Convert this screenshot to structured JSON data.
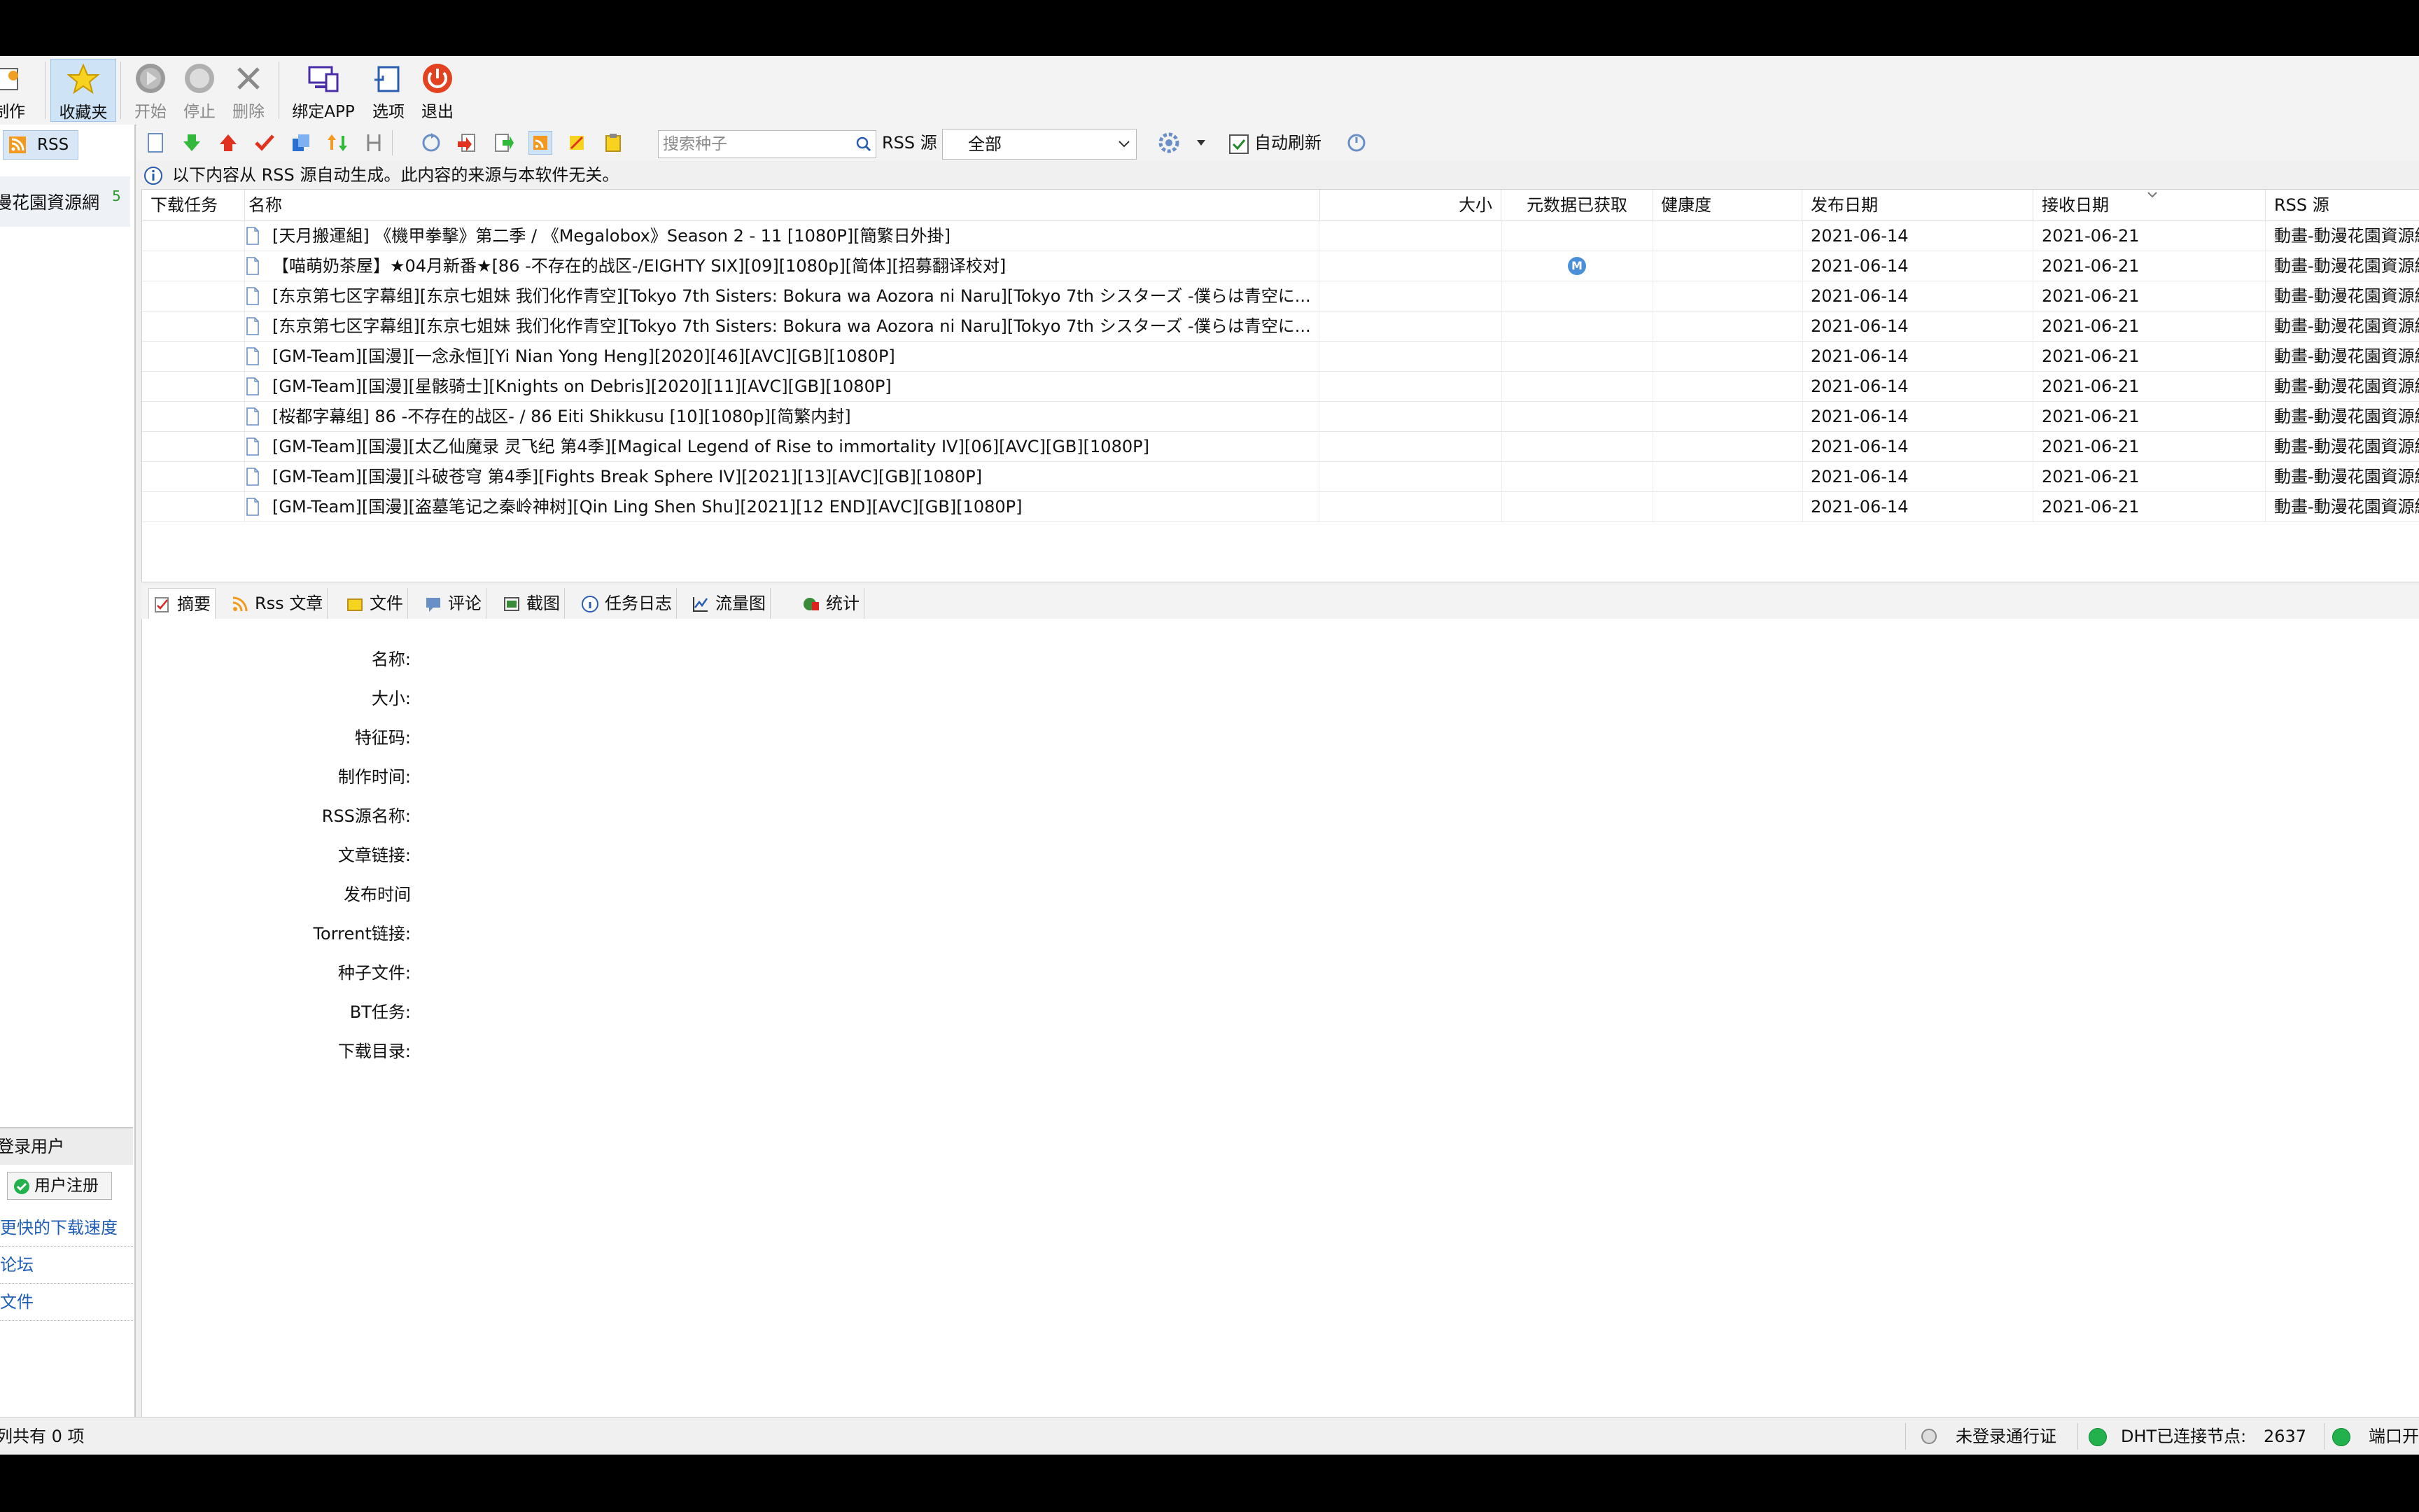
{
  "toolbar": {
    "make_label": "制作",
    "favorites_label": "收藏夹",
    "start_label": "开始",
    "stop_label": "停止",
    "delete_label": "删除",
    "bind_app_label": "绑定APP",
    "options_label": "选项",
    "exit_label": "退出"
  },
  "sidebar": {
    "rss_tab": "RSS",
    "feed_name": "漫花園資源網",
    "feed_count": "5",
    "login_header": "登录用户",
    "register_button": "用户注册",
    "links": [
      "更快的下载速度",
      "论坛",
      "文件"
    ]
  },
  "subbar": {
    "search_placeholder": "搜索种子",
    "rss_source_label": "RSS 源",
    "rss_source_value": "全部",
    "auto_refresh_label": "自动刷新",
    "auto_refresh_checked": true
  },
  "info_text": "以下内容从 RSS 源自动生成。此内容的来源与本软件无关。",
  "table": {
    "columns": [
      "下载任务",
      "名称",
      "大小",
      "元数据已获取",
      "健康度",
      "发布日期",
      "接收日期",
      "RSS 源"
    ],
    "rows": [
      {
        "name": "[天月搬運組] 《機甲拳擊》第二季 / 《Megalobox》Season 2 - 11 [1080P][簡繁日外掛]",
        "meta": "",
        "pub": "2021-06-14",
        "recv": "2021-06-21",
        "source": "動畫-動漫花園資源網"
      },
      {
        "name": "【喵萌奶茶屋】★04月新番★[86 -不存在的战区-/EIGHTY SIX][09][1080p][简体][招募翻译校对]",
        "meta": "M",
        "pub": "2021-06-14",
        "recv": "2021-06-21",
        "source": "動畫-動漫花園資源網"
      },
      {
        "name": "[东京第七区字幕组][东京七姐妹 我们化作青空][Tokyo 7th Sisters: Bokura wa Aozora ni Naru][Tokyo 7th シスターズ -僕らは青空に...",
        "meta": "",
        "pub": "2021-06-14",
        "recv": "2021-06-21",
        "source": "動畫-動漫花園資源網"
      },
      {
        "name": "[东京第七区字幕组][东京七姐妹 我们化作青空][Tokyo 7th Sisters: Bokura wa Aozora ni Naru][Tokyo 7th シスターズ -僕らは青空に...",
        "meta": "",
        "pub": "2021-06-14",
        "recv": "2021-06-21",
        "source": "動畫-動漫花園資源網"
      },
      {
        "name": "[GM-Team][国漫][一念永恒][Yi Nian Yong Heng][2020][46][AVC][GB][1080P]",
        "meta": "",
        "pub": "2021-06-14",
        "recv": "2021-06-21",
        "source": "動畫-動漫花園資源網"
      },
      {
        "name": "[GM-Team][国漫][星骸骑士][Knights on Debris][2020][11][AVC][GB][1080P]",
        "meta": "",
        "pub": "2021-06-14",
        "recv": "2021-06-21",
        "source": "動畫-動漫花園資源網"
      },
      {
        "name": "[桜都字幕组] 86 -不存在的战区- / 86 Eiti Shikkusu [10][1080p][简繁内封]",
        "meta": "",
        "pub": "2021-06-14",
        "recv": "2021-06-21",
        "source": "動畫-動漫花園資源網"
      },
      {
        "name": "[GM-Team][国漫][太乙仙魔录 灵飞纪 第4季][Magical Legend of Rise to immortality IV][06][AVC][GB][1080P]",
        "meta": "",
        "pub": "2021-06-14",
        "recv": "2021-06-21",
        "source": "動畫-動漫花園資源網"
      },
      {
        "name": "[GM-Team][国漫][斗破苍穹 第4季][Fights Break Sphere IV][2021][13][AVC][GB][1080P]",
        "meta": "",
        "pub": "2021-06-14",
        "recv": "2021-06-21",
        "source": "動畫-動漫花園資源網"
      },
      {
        "name": "[GM-Team][国漫][盗墓笔记之秦岭神树][Qin Ling Shen Shu][2021][12 END][AVC][GB][1080P]",
        "meta": "",
        "pub": "2021-06-14",
        "recv": "2021-06-21",
        "source": "動畫-動漫花園資源網"
      }
    ]
  },
  "detail_tabs": [
    "摘要",
    "Rss 文章",
    "文件",
    "评论",
    "截图",
    "任务日志",
    "流量图",
    "统计"
  ],
  "detail_labels": [
    "名称:",
    "大小:",
    "特征码:",
    "制作时间:",
    "RSS源名称:",
    "文章链接:",
    "发布时间",
    "Torrent链接:",
    "种子文件:",
    "BT任务:",
    "下载目录:"
  ],
  "status": {
    "left_text": "列共有 0 项",
    "pass_text": "未登录通行证",
    "dht_label": "DHT已连接节点:",
    "dht_count": "2637",
    "port_text": "端口开"
  },
  "colors": {
    "accent": "#1f5fb5",
    "green": "#22b14c",
    "selection": "#cfe3f6"
  }
}
